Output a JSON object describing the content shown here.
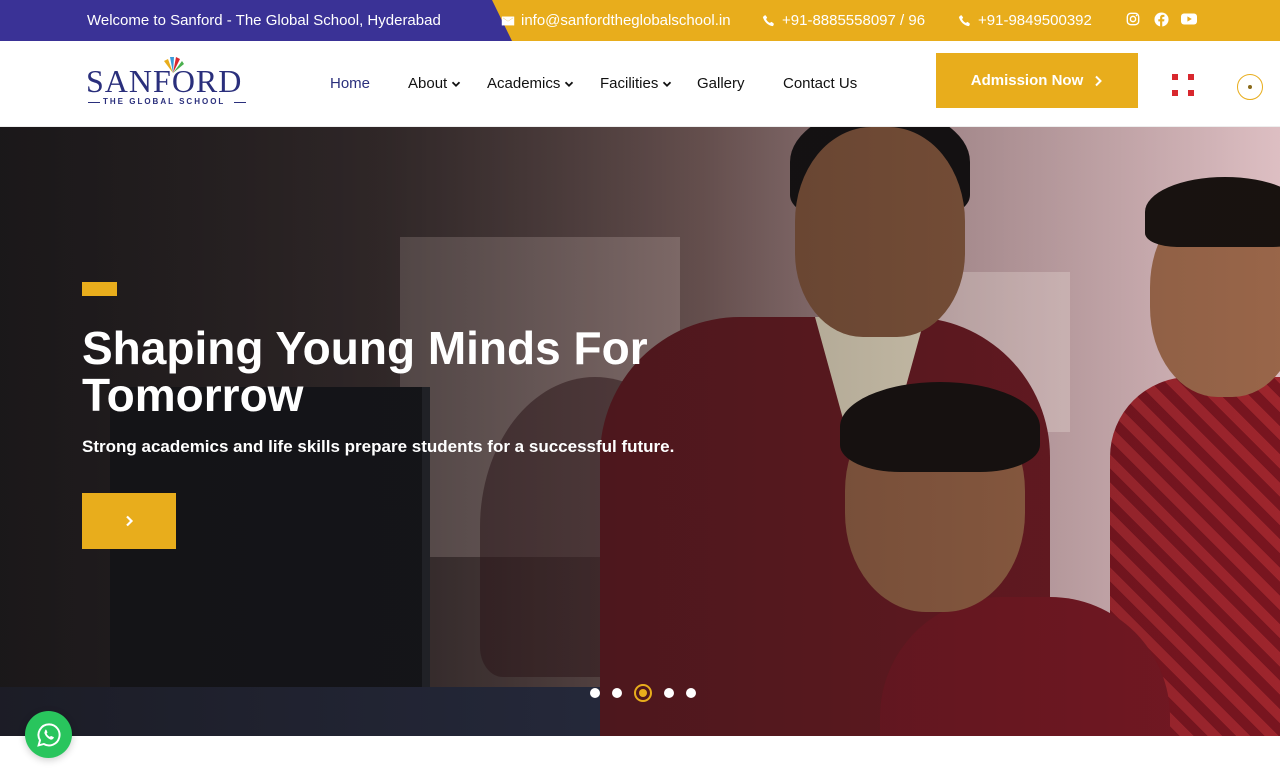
{
  "topbar": {
    "welcome": "Welcome to Sanford - The Global School, Hyderabad",
    "email": "info@sanfordtheglobalschool.in",
    "phone1": "+91-8885558097 / 96",
    "phone2": "+91-9849500392",
    "social_icons": [
      "instagram-icon",
      "facebook-icon",
      "youtube-icon"
    ],
    "bar_color": "#e8ad1c",
    "welcome_bg_color": "#3a3296"
  },
  "header": {
    "logo_text": "SANFORD",
    "logo_subtext": "THE GLOBAL SCHOOL",
    "nav": [
      {
        "label": "Home",
        "active": true,
        "dropdown": false
      },
      {
        "label": "About",
        "active": false,
        "dropdown": true
      },
      {
        "label": "Academics",
        "active": false,
        "dropdown": true
      },
      {
        "label": "Facilities",
        "active": false,
        "dropdown": true
      },
      {
        "label": "Gallery",
        "active": false,
        "dropdown": false
      },
      {
        "label": "Contact Us",
        "active": false,
        "dropdown": false
      }
    ],
    "cta_label": "Admission Now",
    "accent_color": "#e8ad1c",
    "menu_icon_color": "#d8272e"
  },
  "hero": {
    "title": "Shaping Young Minds For Tomorrow",
    "subtitle": "Strong academics and life skills prepare students for a successful future.",
    "slides_count": 5,
    "active_slide": 3
  }
}
